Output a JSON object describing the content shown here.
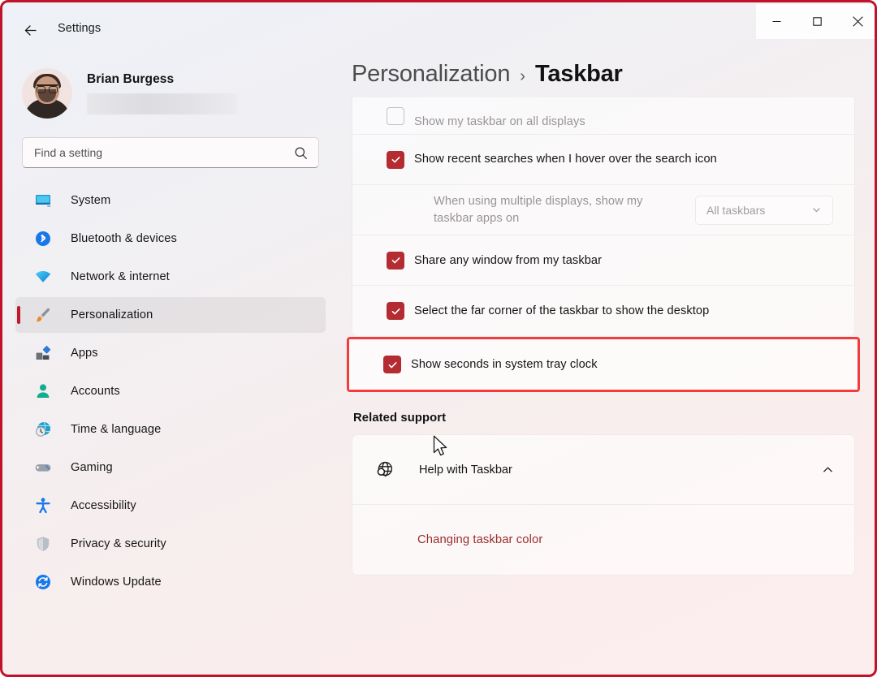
{
  "window": {
    "app_title": "Settings",
    "back_icon": "arrow-left-icon",
    "controls": [
      {
        "name": "minimize",
        "glyph": "minimize-icon"
      },
      {
        "name": "maximize",
        "glyph": "maximize-icon"
      },
      {
        "name": "close",
        "glyph": "close-icon"
      }
    ]
  },
  "account": {
    "name": "Brian Burgess",
    "email_redacted": true
  },
  "search": {
    "placeholder": "Find a setting",
    "value": "",
    "icon": "search-icon"
  },
  "sidebar": {
    "items": [
      {
        "label": "System",
        "icon": "monitor-icon",
        "selected": false
      },
      {
        "label": "Bluetooth & devices",
        "icon": "bluetooth-icon",
        "selected": false
      },
      {
        "label": "Network & internet",
        "icon": "wifi-icon",
        "selected": false
      },
      {
        "label": "Personalization",
        "icon": "paintbrush-icon",
        "selected": true
      },
      {
        "label": "Apps",
        "icon": "apps-icon",
        "selected": false
      },
      {
        "label": "Accounts",
        "icon": "person-icon",
        "selected": false
      },
      {
        "label": "Time & language",
        "icon": "clock-globe-icon",
        "selected": false
      },
      {
        "label": "Gaming",
        "icon": "gamepad-icon",
        "selected": false
      },
      {
        "label": "Accessibility",
        "icon": "accessibility-icon",
        "selected": false
      },
      {
        "label": "Privacy & security",
        "icon": "shield-icon",
        "selected": false
      },
      {
        "label": "Windows Update",
        "icon": "update-icon",
        "selected": false
      }
    ]
  },
  "breadcrumb": {
    "parent": "Personalization",
    "separator": "›",
    "current": "Taskbar"
  },
  "settings": {
    "rows": [
      {
        "label": "Show my taskbar on all displays",
        "control": "checkbox",
        "checked": false,
        "disabled": true,
        "clipped": true
      },
      {
        "label": "Show recent searches when I hover over the search icon",
        "control": "checkbox",
        "checked": true,
        "disabled": false
      },
      {
        "label": "When using multiple displays, show my taskbar apps on",
        "control": "dropdown",
        "dropdown_value": "All taskbars",
        "dropdown_chevron": "chevron-down-icon",
        "disabled": true
      },
      {
        "label": "Share any window from my taskbar",
        "control": "checkbox",
        "checked": true,
        "disabled": false
      },
      {
        "label": "Select the far corner of the taskbar to show the desktop",
        "control": "checkbox",
        "checked": true,
        "disabled": false
      }
    ],
    "highlighted_row": {
      "label": "Show seconds in system tray clock",
      "control": "checkbox",
      "checked": true,
      "disabled": false,
      "annotation_color": "#f23b3b"
    }
  },
  "related_support": {
    "title": "Related support",
    "help_row": {
      "label": "Help with Taskbar",
      "icon": "globe-search-icon",
      "chevron": "chevron-up-icon",
      "expanded": true
    },
    "links": [
      {
        "label": "Changing taskbar color"
      }
    ]
  },
  "colors": {
    "accent_red": "#bf1b2c",
    "checkbox_red": "#b52b32",
    "annotation_red": "#f23b3b",
    "frame_red": "#c0132a",
    "link_red": "#9b2c2c"
  },
  "cursor": {
    "icon": "mouse-pointer-icon",
    "visible": true
  }
}
